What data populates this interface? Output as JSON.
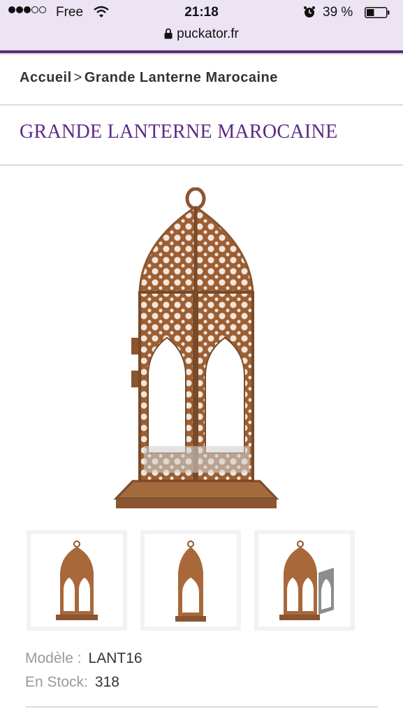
{
  "status_bar": {
    "signal_strength": "3 of 5",
    "carrier": "Free",
    "time": "21:18",
    "battery": "39 %",
    "battery_level": 0.39
  },
  "url_bar": {
    "url": "puckator.fr"
  },
  "breadcrumb": {
    "home": "Accueil",
    "separator": ">",
    "current": "Grande Lanterne Marocaine"
  },
  "product": {
    "title": "GRANDE LANTERNE MAROCAINE",
    "model_label": "Modèle :",
    "model_value": "LANT16",
    "stock_label": "En Stock:",
    "stock_value": "318"
  },
  "colors": {
    "accent": "#5b2a86",
    "topbar": "#ede4f3",
    "copper": "#a8683a"
  }
}
